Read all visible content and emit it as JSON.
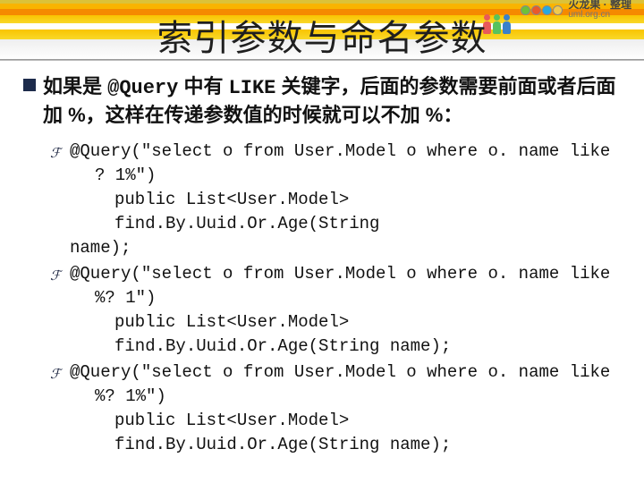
{
  "brand": {
    "name": "火龙果 · 整理",
    "site": "uml.org.cn"
  },
  "title": "索引参数与命名参数",
  "lead": {
    "prefix": "如果是 ",
    "query": "@Query",
    "mid": " 中有 ",
    "like": "LIKE",
    "rest": " 关键字，后面的参数需要前面或者后面加 %，这样在传递参数值的时候就可以不加 %："
  },
  "items": [
    {
      "l1": "@Query(\"select o from User.Model o where o. name like",
      "l2": "? 1%\")",
      "l3": "public List<User.Model> find.By.Uuid.Or.Age(String",
      "l4": "name);"
    },
    {
      "l1": "@Query(\"select o from User.Model o where o. name like",
      "l2": "%? 1\")",
      "l3": "public List<User.Model> find.By.Uuid.Or.Age(String name);"
    },
    {
      "l1": "@Query(\"select o from User.Model o where o. name like",
      "l2": "%? 1%\")",
      "l3": "public List<User.Model> find.By.Uuid.Or.Age(String name);"
    }
  ]
}
